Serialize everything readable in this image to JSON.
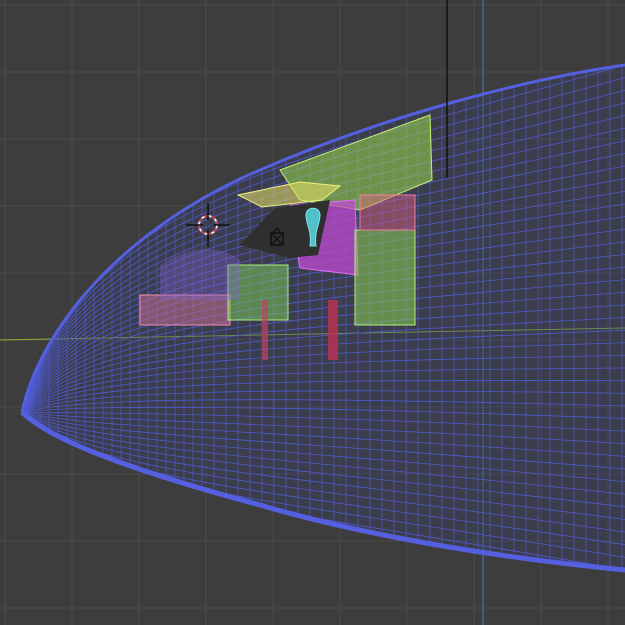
{
  "viewport": {
    "background": "#3d3d3d",
    "grid_color": "#4a4a4a",
    "x_axis_color": "#8fb33a",
    "y_axis_color": "#4a7bb8",
    "mesh_color": "#4a55c8",
    "icons": {
      "cursor": "3d-cursor-icon",
      "camera": "camera-object-icon"
    }
  }
}
